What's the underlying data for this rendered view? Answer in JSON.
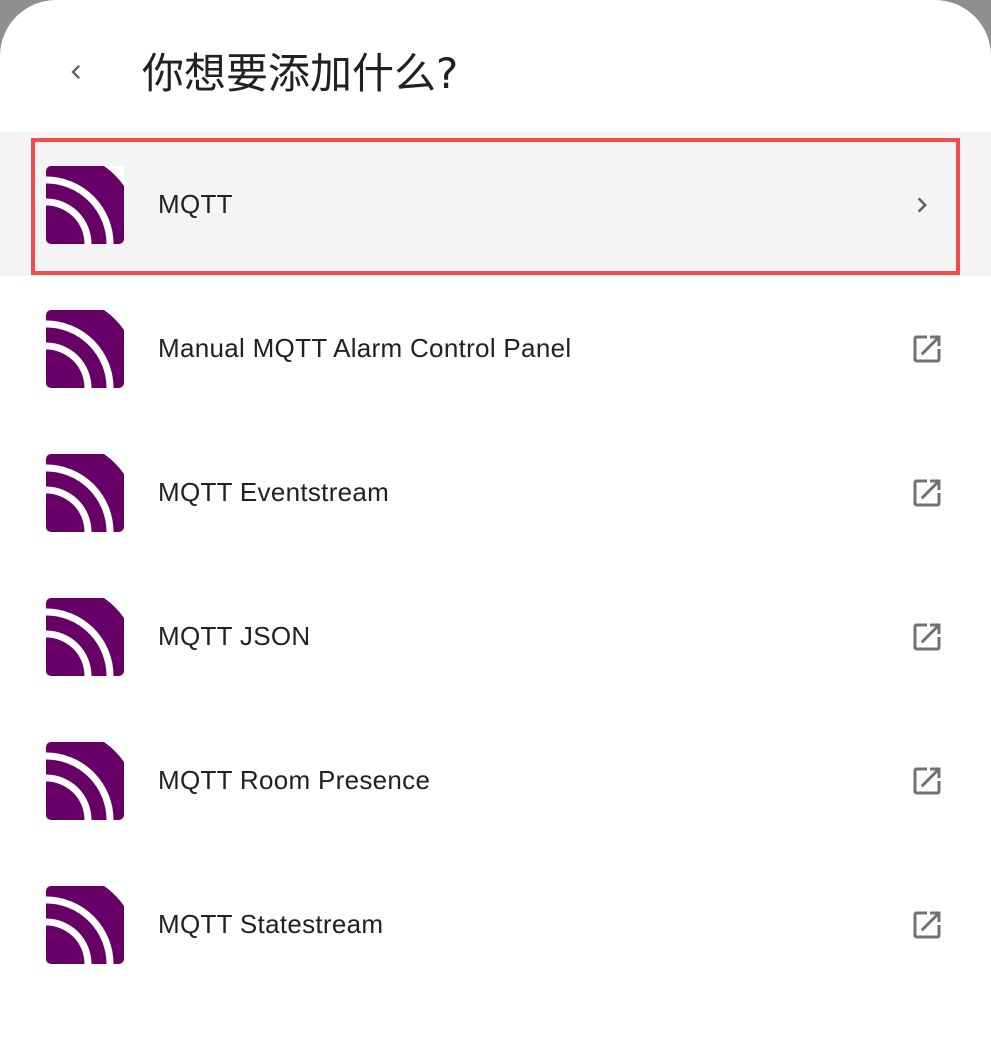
{
  "header": {
    "back_icon": "chevron-left-icon",
    "title": "你想要添加什么?"
  },
  "brand": {
    "icon": "mqtt-icon",
    "icon_color": "#660066",
    "highlight_color": "#f44b4b"
  },
  "items": [
    {
      "label": "MQTT",
      "trailing_icon": "chevron-right-icon",
      "selected": true
    },
    {
      "label": "Manual MQTT Alarm Control Panel",
      "trailing_icon": "open-in-new-icon",
      "selected": false
    },
    {
      "label": "MQTT Eventstream",
      "trailing_icon": "open-in-new-icon",
      "selected": false
    },
    {
      "label": "MQTT JSON",
      "trailing_icon": "open-in-new-icon",
      "selected": false
    },
    {
      "label": "MQTT Room Presence",
      "trailing_icon": "open-in-new-icon",
      "selected": false
    },
    {
      "label": "MQTT Statestream",
      "trailing_icon": "open-in-new-icon",
      "selected": false
    }
  ]
}
